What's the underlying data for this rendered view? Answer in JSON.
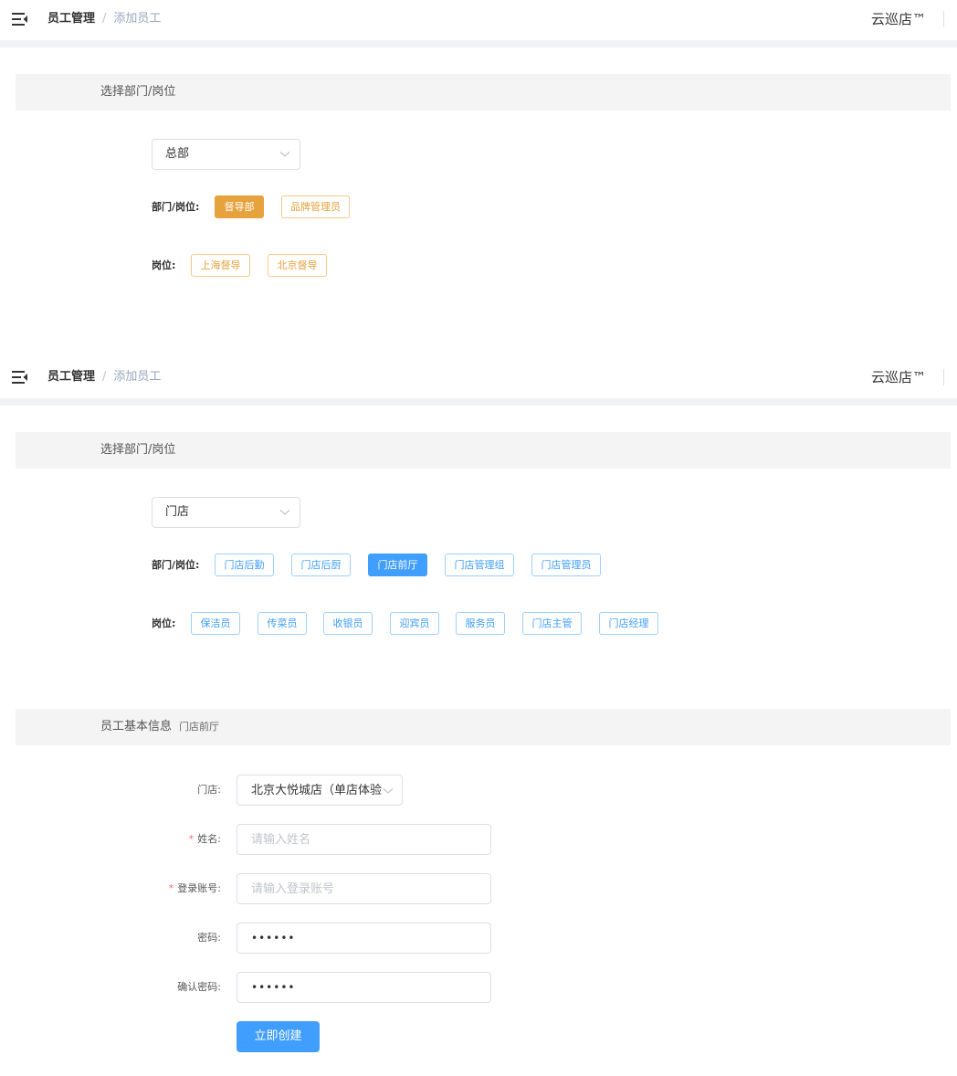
{
  "topbar": {
    "breadcrumb_root": "员工管理",
    "breadcrumb_sep": "/",
    "breadcrumb_current": "添加员工",
    "brand": "云巡店™"
  },
  "screen1": {
    "section_title": "选择部门/岗位",
    "org_select": {
      "value": "总部"
    },
    "dept_label": "部门/岗位:",
    "depts": [
      {
        "label": "督导部",
        "active": true
      },
      {
        "label": "品牌管理员",
        "active": false
      }
    ],
    "post_label": "岗位:",
    "posts": [
      {
        "label": "上海督导"
      },
      {
        "label": "北京督导"
      }
    ]
  },
  "screen2": {
    "section_title": "选择部门/岗位",
    "org_select": {
      "value": "门店"
    },
    "dept_label": "部门/岗位:",
    "depts": [
      {
        "label": "门店后勤",
        "active": false
      },
      {
        "label": "门店后厨",
        "active": false
      },
      {
        "label": "门店前厅",
        "active": true
      },
      {
        "label": "门店管理组",
        "active": false
      },
      {
        "label": "门店管理员",
        "active": false
      }
    ],
    "post_label": "岗位:",
    "posts": [
      {
        "label": "保洁员"
      },
      {
        "label": "传菜员"
      },
      {
        "label": "收银员"
      },
      {
        "label": "迎宾员"
      },
      {
        "label": "服务员"
      },
      {
        "label": "门店主管"
      },
      {
        "label": "门店经理"
      }
    ],
    "info": {
      "section_title": "员工基本信息",
      "section_subtitle": "门店前厅",
      "store_label": "门店:",
      "store_value": "北京大悦城店（单店体验",
      "name_label": "姓名:",
      "name_placeholder": "请输入姓名",
      "account_label": "登录账号:",
      "account_placeholder": "请输入登录账号",
      "password_label": "密码:",
      "password_value": "••••••",
      "confirm_label": "确认密码:",
      "confirm_value": "••••••",
      "required_mark": "*",
      "submit_label": "立即创建"
    }
  }
}
